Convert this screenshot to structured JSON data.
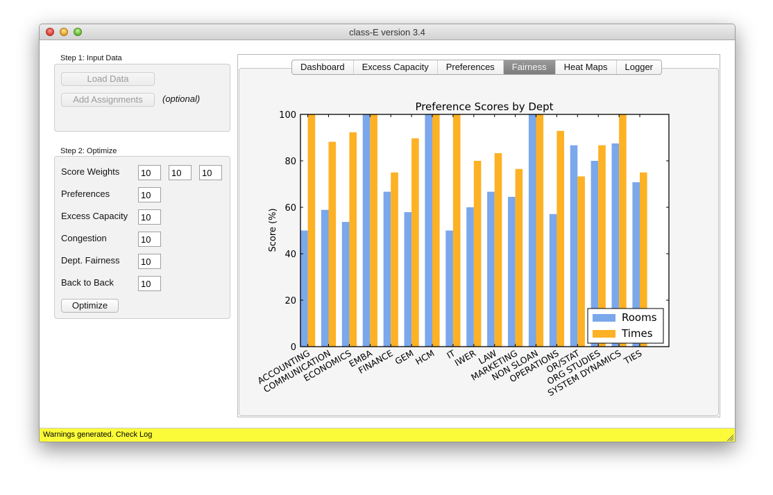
{
  "window": {
    "title": "class-E   version 3.4"
  },
  "step1": {
    "label": "Step 1: Input Data",
    "load_data": "Load Data",
    "add_assignments": "Add Assignments",
    "optional": "(optional)"
  },
  "step2": {
    "label": "Step 2: Optimize",
    "score_weights_label": "Score Weights",
    "score_weights": [
      "10",
      "10",
      "10"
    ],
    "fields": [
      {
        "label": "Preferences",
        "value": "10"
      },
      {
        "label": "Excess Capacity",
        "value": "10"
      },
      {
        "label": "Congestion",
        "value": "10"
      },
      {
        "label": "Dept. Fairness",
        "value": "10"
      },
      {
        "label": "Back to Back",
        "value": "10"
      }
    ],
    "optimize": "Optimize"
  },
  "tabs": [
    {
      "label": "Dashboard",
      "active": false
    },
    {
      "label": "Excess Capacity",
      "active": false
    },
    {
      "label": "Preferences",
      "active": false
    },
    {
      "label": "Fairness",
      "active": true
    },
    {
      "label": "Heat Maps",
      "active": false
    },
    {
      "label": "Logger",
      "active": false
    }
  ],
  "status": {
    "text": "Warnings generated. Check Log",
    "color": "#fbfb3a"
  },
  "chart_data": {
    "type": "bar",
    "title": "Preference Scores by Dept",
    "xlabel": "",
    "ylabel": "Score (%)",
    "ylim": [
      0,
      100
    ],
    "yticks": [
      0,
      20,
      40,
      60,
      80,
      100
    ],
    "grid": false,
    "legend_position": "bottom-right",
    "categories": [
      "ACCOUNTING",
      "COMMUNICATION",
      "ECONOMICS",
      "EMBA",
      "FINANCE",
      "GEM",
      "HCM",
      "IT",
      "IWER",
      "LAW",
      "MARKETING",
      "NON SLOAN",
      "OPERATIONS",
      "OR/STAT",
      "ORG STUDIES",
      "SYSTEM DYNAMICS",
      "TIES"
    ],
    "series": [
      {
        "name": "Rooms",
        "color": "#7ba7eb",
        "values": [
          50,
          58.9,
          53.7,
          100,
          66.7,
          57.9,
          100,
          50,
          60,
          66.7,
          64.5,
          100,
          57.1,
          86.7,
          80,
          87.5,
          70.8
        ]
      },
      {
        "name": "Times",
        "color": "#fdb124",
        "values": [
          100,
          88.2,
          92.3,
          100,
          75,
          89.7,
          100,
          100,
          80,
          83.3,
          76.5,
          100,
          92.9,
          73.3,
          86.7,
          100,
          75
        ]
      }
    ]
  }
}
